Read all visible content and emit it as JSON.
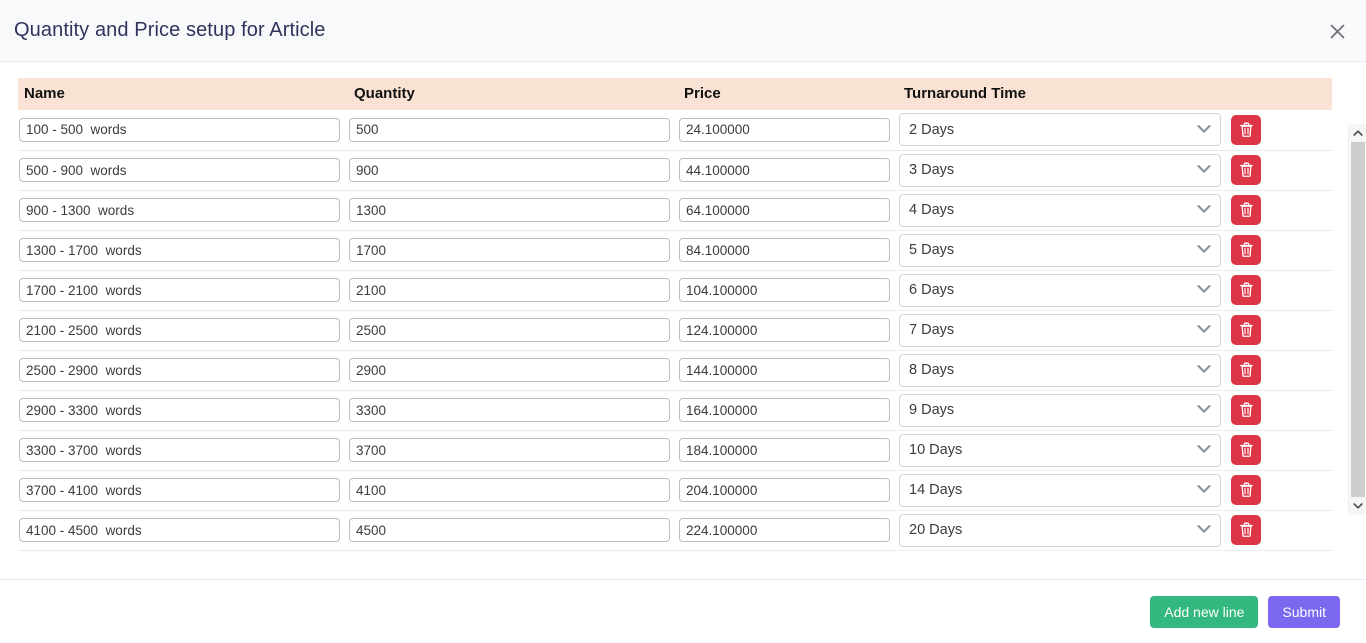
{
  "header": {
    "title": "Quantity and Price setup for Article",
    "close_icon": "close-icon"
  },
  "table": {
    "columns": [
      "Name",
      "Quantity",
      "Price",
      "Turnaround Time"
    ],
    "rows": [
      {
        "name": "100 - 500  words",
        "quantity": "500",
        "price": "24.100000",
        "turnaround": "2 Days"
      },
      {
        "name": "500 - 900  words",
        "quantity": "900",
        "price": "44.100000",
        "turnaround": "3 Days"
      },
      {
        "name": "900 - 1300  words",
        "quantity": "1300",
        "price": "64.100000",
        "turnaround": "4 Days"
      },
      {
        "name": "1300 - 1700  words",
        "quantity": "1700",
        "price": "84.100000",
        "turnaround": "5 Days"
      },
      {
        "name": "1700 - 2100  words",
        "quantity": "2100",
        "price": "104.100000",
        "turnaround": "6 Days"
      },
      {
        "name": "2100 - 2500  words",
        "quantity": "2500",
        "price": "124.100000",
        "turnaround": "7 Days"
      },
      {
        "name": "2500 - 2900  words",
        "quantity": "2900",
        "price": "144.100000",
        "turnaround": "8 Days"
      },
      {
        "name": "2900 - 3300  words",
        "quantity": "3300",
        "price": "164.100000",
        "turnaround": "9 Days"
      },
      {
        "name": "3300 - 3700  words",
        "quantity": "3700",
        "price": "184.100000",
        "turnaround": "10 Days"
      },
      {
        "name": "3700 - 4100  words",
        "quantity": "4100",
        "price": "204.100000",
        "turnaround": "14 Days"
      },
      {
        "name": "4100 - 4500  words",
        "quantity": "4500",
        "price": "224.100000",
        "turnaround": "20 Days"
      }
    ],
    "delete_icon": "trash-icon",
    "select_chevron_icon": "chevron-down-icon"
  },
  "footer": {
    "add_label": "Add new line",
    "submit_label": "Submit"
  },
  "scrollbar": {
    "up_icon": "chevron-up-icon",
    "down_icon": "chevron-down-icon"
  },
  "colors": {
    "header_row": "#f9e2d4",
    "delete": "#dc3545",
    "add": "#33b87f",
    "submit": "#7a68ef",
    "title_text": "#32325d"
  }
}
